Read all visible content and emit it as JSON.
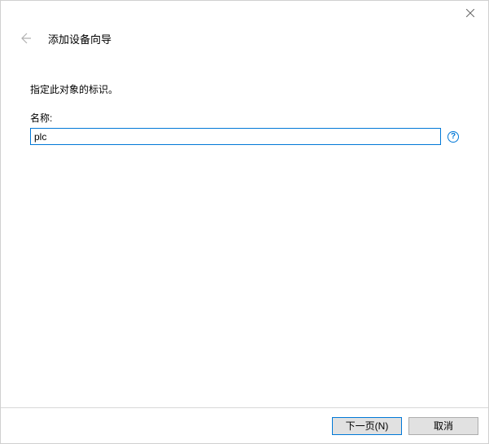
{
  "titlebar": {
    "close_icon": "close"
  },
  "header": {
    "back_icon": "arrow-left",
    "title": "添加设备向导"
  },
  "content": {
    "instruction": "指定此对象的标识。",
    "name_label": "名称:",
    "name_value": "plc",
    "help_symbol": "?"
  },
  "footer": {
    "next_label": "下一页(N)",
    "cancel_label": "取消"
  }
}
